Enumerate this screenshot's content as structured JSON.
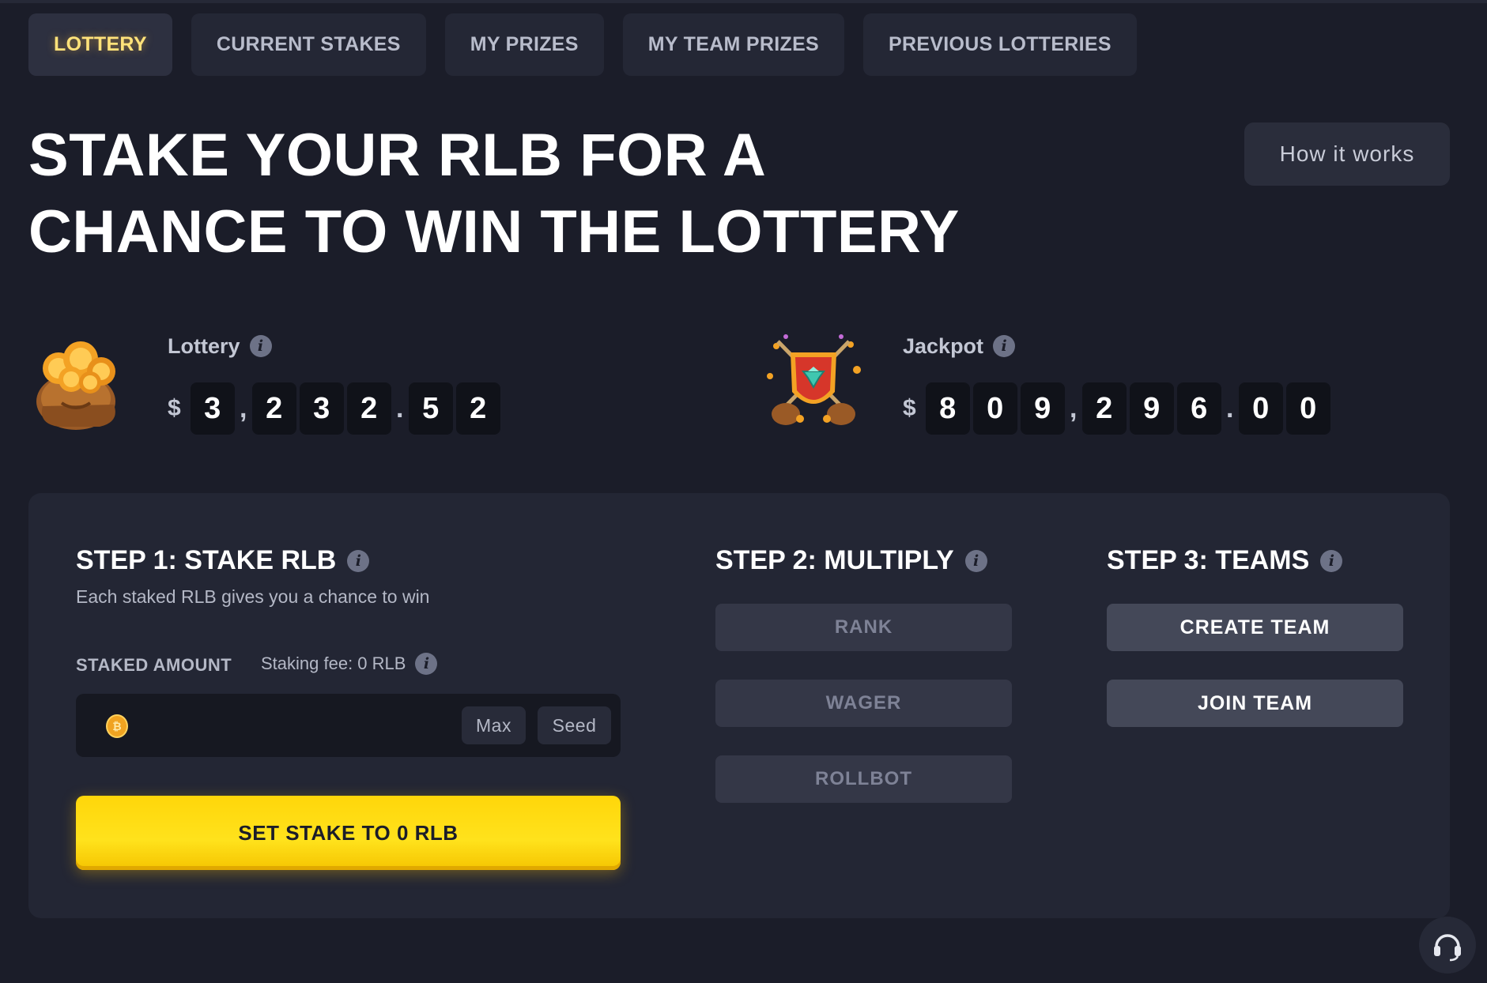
{
  "tabs": [
    {
      "label": "LOTTERY",
      "active": true
    },
    {
      "label": "CURRENT STAKES",
      "active": false
    },
    {
      "label": "MY PRIZES",
      "active": false
    },
    {
      "label": "MY TEAM PRIZES",
      "active": false
    },
    {
      "label": "PREVIOUS LOTTERIES",
      "active": false
    }
  ],
  "hero": {
    "title_line1": "STAKE YOUR RLB FOR A",
    "title_line2": "CHANCE TO WIN THE LOTTERY",
    "how_it_works": "How it works"
  },
  "prizes": {
    "lottery": {
      "label": "Lottery",
      "currency": "$",
      "digits": [
        "3",
        ",",
        "2",
        "3",
        "2",
        ".",
        "5",
        "2"
      ],
      "icon": "coin-bag-icon"
    },
    "jackpot": {
      "label": "Jackpot",
      "currency": "$",
      "digits": [
        "8",
        "0",
        "9",
        ",",
        "2",
        "9",
        "6",
        ".",
        "0",
        "0"
      ],
      "icon": "shield-emblem-icon"
    }
  },
  "step1": {
    "title": "STEP 1: STAKE RLB",
    "description": "Each staked RLB gives you a chance to win",
    "staked_amount_label": "STAKED AMOUNT",
    "staking_fee": "Staking fee: 0 RLB",
    "input_value": "",
    "max_label": "Max",
    "seed_label": "Seed",
    "submit_label": "SET STAKE TO 0 RLB"
  },
  "step2": {
    "title": "STEP 2: MULTIPLY",
    "buttons": [
      "RANK",
      "WAGER",
      "ROLLBOT"
    ]
  },
  "step3": {
    "title": "STEP 3: TEAMS",
    "create_team": "CREATE TEAM",
    "join_team": "JOIN TEAM"
  },
  "colors": {
    "background": "#1b1d29",
    "panel": "#232634",
    "accent_yellow": "#ffd60a",
    "active_tab_text": "#ffe27a"
  }
}
